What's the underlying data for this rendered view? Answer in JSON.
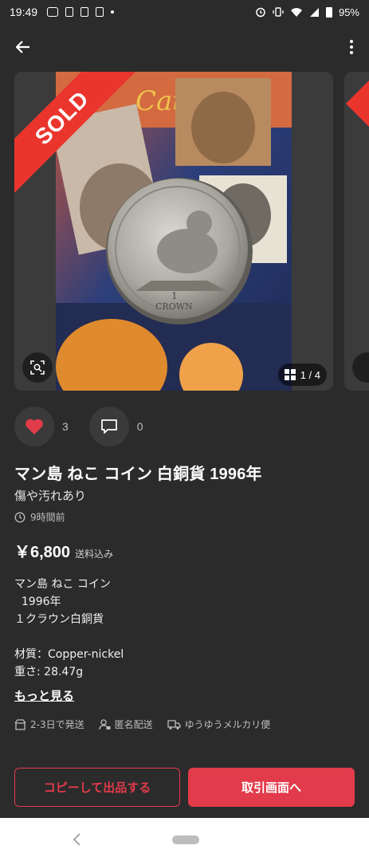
{
  "status_bar": {
    "time": "19:49",
    "battery": "95%"
  },
  "listing": {
    "badge": "SOLD",
    "photo_counter": "1 / 4",
    "likes": "3",
    "comments": "0",
    "title": "マン島 ねこ コイン 白銅貨 1996年",
    "condition": "傷や汚れあり",
    "posted": "9時間前",
    "price": "￥6,800",
    "shipping_note": "送料込み",
    "description": [
      "マン島 ねこ コイン",
      "  1996年",
      "１クラウン白銅貨",
      "",
      "材質：Copper-nickel",
      "重さ: 28.47g"
    ],
    "more_label": "もっと見る",
    "meta": {
      "ship_days": "2-3日で発送",
      "anonymous": "匿名配送",
      "method": "ゆうゆうメルカリ便"
    }
  },
  "buttons": {
    "copy": "コピーして出品する",
    "trade": "取引画面へ"
  },
  "image_text": {
    "book_title": "Cats",
    "coin_value": "1",
    "coin_denomination": "CROWN"
  },
  "colors": {
    "accent": "#e23b4b",
    "sold_ribbon": "#ea352d",
    "background": "#2b2b2b"
  }
}
